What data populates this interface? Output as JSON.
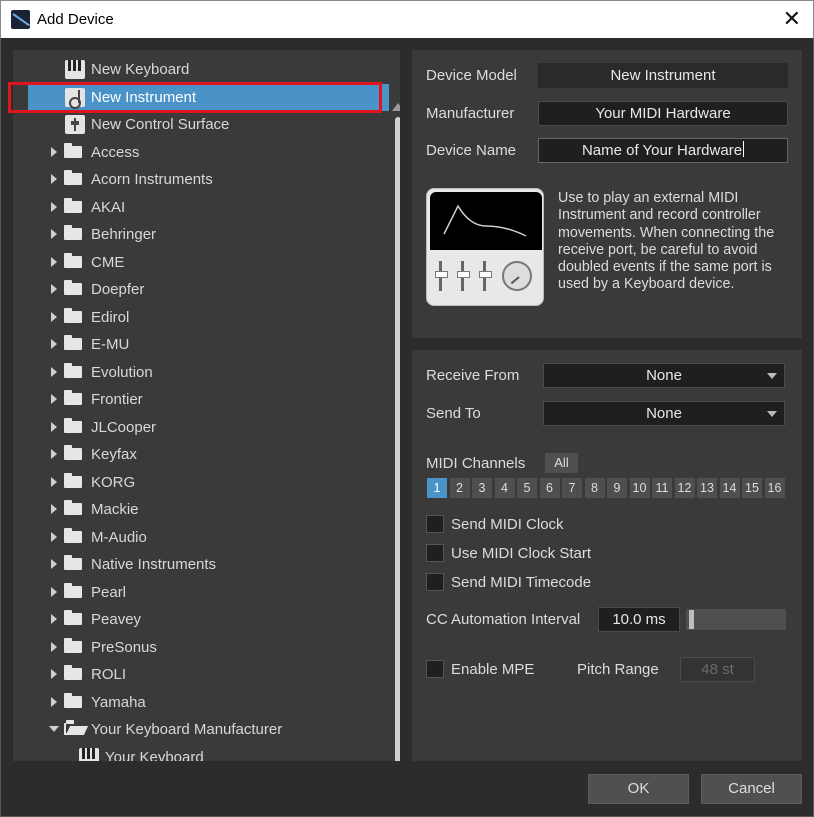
{
  "window": {
    "title": "Add Device",
    "close_glyph": "✕"
  },
  "tree": {
    "selected_index": 1,
    "items": [
      {
        "label": "New Keyboard",
        "kind": "keyboard"
      },
      {
        "label": "New Instrument",
        "kind": "instrument"
      },
      {
        "label": "New Control Surface",
        "kind": "control"
      },
      {
        "label": "Access",
        "kind": "folder"
      },
      {
        "label": "Acorn Instruments",
        "kind": "folder"
      },
      {
        "label": "AKAI",
        "kind": "folder"
      },
      {
        "label": "Behringer",
        "kind": "folder"
      },
      {
        "label": "CME",
        "kind": "folder"
      },
      {
        "label": "Doepfer",
        "kind": "folder"
      },
      {
        "label": "Edirol",
        "kind": "folder"
      },
      {
        "label": "E-MU",
        "kind": "folder"
      },
      {
        "label": "Evolution",
        "kind": "folder"
      },
      {
        "label": "Frontier",
        "kind": "folder"
      },
      {
        "label": "JLCooper",
        "kind": "folder"
      },
      {
        "label": "Keyfax",
        "kind": "folder"
      },
      {
        "label": "KORG",
        "kind": "folder"
      },
      {
        "label": "Mackie",
        "kind": "folder"
      },
      {
        "label": "M-Audio",
        "kind": "folder"
      },
      {
        "label": "Native Instruments",
        "kind": "folder"
      },
      {
        "label": "Pearl",
        "kind": "folder"
      },
      {
        "label": "Peavey",
        "kind": "folder"
      },
      {
        "label": "PreSonus",
        "kind": "folder"
      },
      {
        "label": "ROLI",
        "kind": "folder"
      },
      {
        "label": "Yamaha",
        "kind": "folder"
      },
      {
        "label": "Your Keyboard Manufacturer",
        "kind": "folder-open"
      },
      {
        "label": "Your Keyboard",
        "kind": "keyboard-child"
      }
    ]
  },
  "device": {
    "model_label": "Device Model",
    "model_value": "New Instrument",
    "manufacturer_label": "Manufacturer",
    "manufacturer_value": "Your MIDI Hardware",
    "name_label": "Device Name",
    "name_value": "Name of Your Hardware",
    "description": "Use to play an external MIDI Instrument and record controller movements. When connecting the receive port, be careful to avoid doubled events if the same port is used by a Keyboard device.",
    "icon": "instrument-graphic-icon"
  },
  "routing": {
    "receive_label": "Receive From",
    "receive_value": "None",
    "send_label": "Send To",
    "send_value": "None"
  },
  "channels": {
    "label": "MIDI Channels",
    "all_label": "All",
    "items": [
      "1",
      "2",
      "3",
      "4",
      "5",
      "6",
      "7",
      "8",
      "9",
      "10",
      "11",
      "12",
      "13",
      "14",
      "15",
      "16"
    ],
    "active": [
      "1"
    ]
  },
  "options": {
    "send_clock": "Send MIDI Clock",
    "clock_start": "Use MIDI Clock Start",
    "send_timecode": "Send MIDI Timecode",
    "cc_label": "CC Automation Interval",
    "cc_value": "10.0 ms",
    "cc_slider_level": 0.02,
    "enable_mpe": "Enable MPE",
    "pitch_label": "Pitch Range",
    "pitch_value": "48 st"
  },
  "buttons": {
    "ok": "OK",
    "cancel": "Cancel"
  },
  "colors": {
    "accent": "#4a93c9",
    "highlight_outline": "#e0141c",
    "panel": "#3a3a3a",
    "background": "#2c2c2c"
  }
}
